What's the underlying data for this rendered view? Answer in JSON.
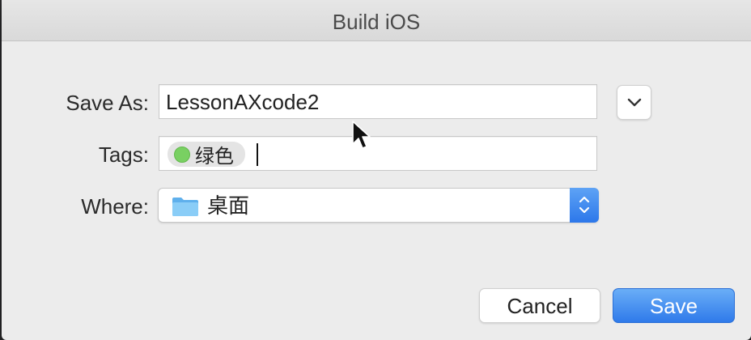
{
  "window": {
    "title": "Build iOS"
  },
  "form": {
    "save_as_label": "Save As:",
    "save_as_value": "LessonAXcode2",
    "tags_label": "Tags:",
    "tag_name": "绿色",
    "tag_color": "#79d062",
    "where_label": "Where:",
    "where_value": "桌面",
    "where_icon": "folder-icon"
  },
  "buttons": {
    "cancel_label": "Cancel",
    "save_label": "Save"
  },
  "colors": {
    "accent": "#2f7aea",
    "dialog_bg": "#ececec"
  }
}
